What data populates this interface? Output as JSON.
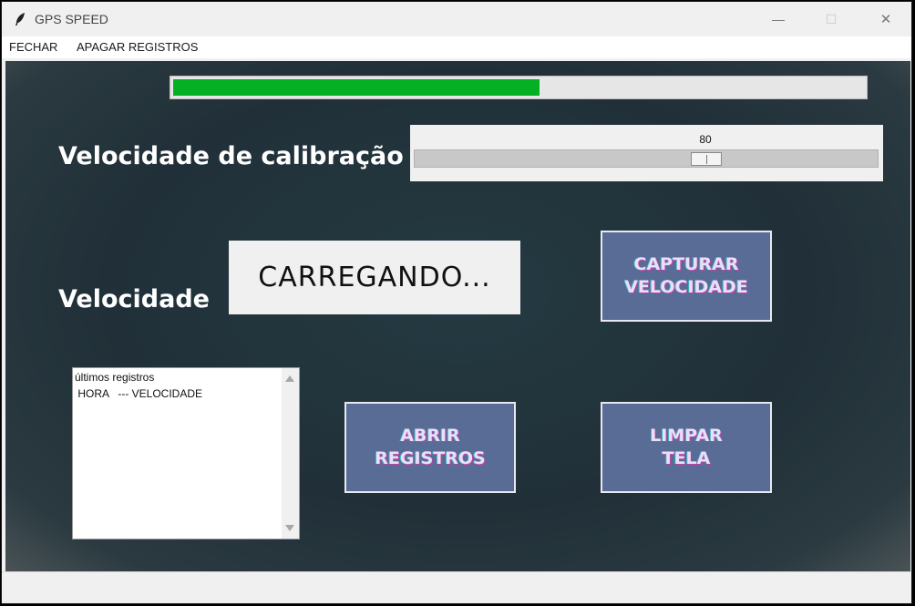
{
  "window": {
    "title": "GPS SPEED",
    "minimize": "—",
    "maximize": "☐",
    "close": "✕"
  },
  "menu": {
    "items": [
      "FECHAR",
      "APAGAR REGISTROS"
    ]
  },
  "progress": {
    "fraction": 0.53,
    "color": "#06b025"
  },
  "calibration": {
    "label": "Velocidade de calibração",
    "value": "80",
    "fraction": 0.64
  },
  "speed": {
    "label": "Velocidade",
    "display": "CARREGANDO..."
  },
  "buttons": {
    "capture": "CAPTURAR\nVELOCIDADE",
    "open": "ABRIR\nREGISTROS",
    "clear": "LIMPAR\nTELA"
  },
  "records": {
    "lines": [
      "últimos registros",
      " HORA   --- VELOCIDADE"
    ]
  },
  "colors": {
    "background": "#213038",
    "button": "#586c96",
    "window": "#f0f0f0"
  },
  "icons": {
    "app": "feather-icon"
  }
}
